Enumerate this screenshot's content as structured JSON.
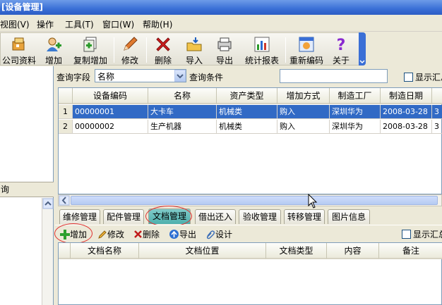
{
  "window": {
    "title": "[设备管理]"
  },
  "menu": {
    "items": [
      "视图(V)",
      "操作",
      "工具(T)",
      "窗口(W)",
      "帮助(H)"
    ]
  },
  "toolbar": {
    "buttons": [
      {
        "label": "公司资料",
        "icon": "company-icon"
      },
      {
        "label": "增加",
        "icon": "add-user-icon"
      },
      {
        "label": "复制增加",
        "icon": "copy-add-icon"
      },
      {
        "label": "修改",
        "icon": "pencil-icon"
      },
      {
        "label": "删除",
        "icon": "delete-x-icon"
      },
      {
        "label": "导入",
        "icon": "import-icon"
      },
      {
        "label": "导出",
        "icon": "export-icon"
      },
      {
        "label": "统计报表",
        "icon": "chart-icon"
      },
      {
        "label": "重新编码",
        "icon": "recode-icon"
      },
      {
        "label": "关于",
        "icon": "question-icon"
      }
    ]
  },
  "left": {
    "query_label": "询"
  },
  "search": {
    "field_label": "查询字段",
    "field_value": "名称",
    "condition_label": "查询条件",
    "condition_value": "",
    "show_summary_label": "显示汇总"
  },
  "grid1": {
    "columns": [
      "设备编码",
      "名称",
      "资产类型",
      "增加方式",
      "制造工厂",
      "制造日期"
    ],
    "rows": [
      {
        "num": "1",
        "cells": [
          "00000001",
          "大卡车",
          "机械类",
          "购入",
          "深圳华为",
          "2008-03-28",
          "3"
        ]
      },
      {
        "num": "2",
        "cells": [
          "00000002",
          "生产机器",
          "机械类",
          "购入",
          "深圳华为",
          "2008-03-28",
          "3"
        ]
      }
    ]
  },
  "tabs": {
    "items": [
      "维修管理",
      "配件管理",
      "文档管理",
      "借出还入",
      "验收管理",
      "转移管理",
      "图片信息"
    ],
    "active": "文档管理"
  },
  "bottom_toolbar": {
    "add": "增加",
    "edit": "修改",
    "delete": "删除",
    "export": "导出",
    "settings": "设计",
    "show_summary_label": "显示汇总"
  },
  "grid2": {
    "columns": [
      "文档名称",
      "文档位置",
      "文档类型",
      "内容",
      "备注"
    ]
  },
  "colors": {
    "title_bar": "#3a6fd6",
    "selection": "#316ac5",
    "active_tab": "#4eb0ad",
    "highlight_ring": "#e03030"
  }
}
